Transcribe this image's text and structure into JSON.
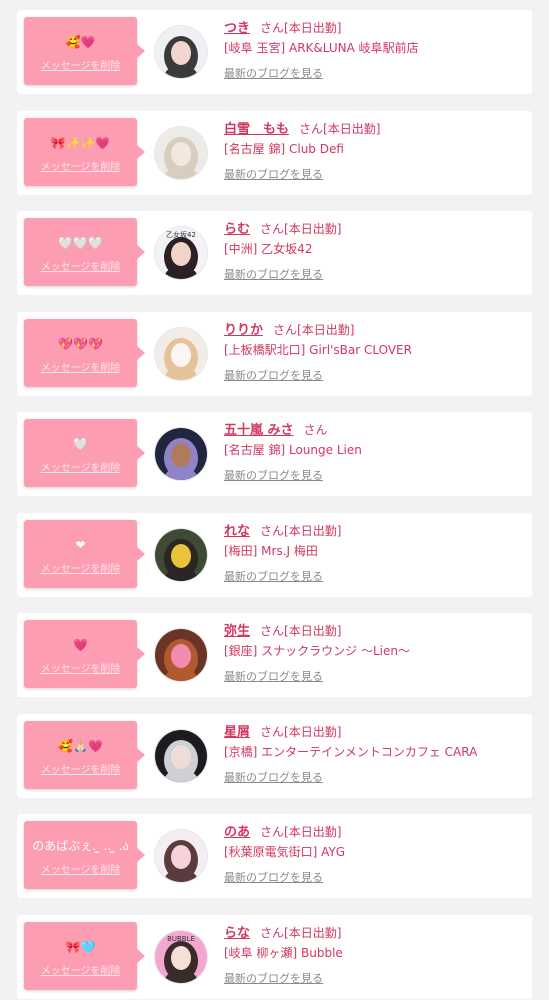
{
  "colors": {
    "page_background": "#f2f2f4",
    "card_background": "#ffffff",
    "bubble_pink": "#fd9db1",
    "name_pink": "#d3375f",
    "link_gray": "#8a8a8a"
  },
  "cards": [
    {
      "message": "🥰💗",
      "delete_label": "メッセージを削除",
      "name": "つき",
      "honorific": "さん",
      "status": "[本日出勤]",
      "shop": "[岐阜 玉宮] ARK&LUNA 岐阜駅前店",
      "blog_link": "最新のブログを見る",
      "avatar_colors": [
        "#eef0f4",
        "#3a3a3a",
        "#f0d6cf"
      ]
    },
    {
      "message": "🎀✨✨💗",
      "delete_label": "メッセージを削除",
      "name": "白雪　もも",
      "honorific": "さん",
      "status": "[本日出勤]",
      "shop": "[名古屋 錦] Club Defi",
      "blog_link": "最新のブログを見る",
      "avatar_colors": [
        "#ecebea",
        "#d8cdbf",
        "#f3e8df"
      ]
    },
    {
      "message": "🤍🤍🤍",
      "delete_label": "メッセージを削除",
      "name": "らむ",
      "honorific": "さん",
      "status": "[本日出勤]",
      "shop": "[中洲] 乙女坂42",
      "blog_link": "最新のブログを見る",
      "avatar_colors": [
        "#f4f2f6",
        "#2b2124",
        "#f1d4c8"
      ],
      "avatar_caption": "乙女坂42"
    },
    {
      "message": "💖💖💖",
      "delete_label": "メッセージを削除",
      "name": "りりか",
      "honorific": "さん",
      "status": "[本日出勤]",
      "shop": "[上板橋駅北口] Girl'sBar CLOVER",
      "blog_link": "最新のブログを見る",
      "avatar_colors": [
        "#f3ece6",
        "#e6c29b",
        "#fbf6f3"
      ]
    },
    {
      "message": "🤍",
      "delete_label": "メッセージを削除",
      "name": "五十嵐 みさ",
      "honorific": "さん",
      "status": "",
      "shop": "[名古屋 錦] Lounge Lien",
      "blog_link": "最新のブログを見る",
      "avatar_colors": [
        "#202540",
        "#8f84c9",
        "#b07a5e"
      ]
    },
    {
      "message": "❤",
      "delete_label": "メッセージを削除",
      "name": "れな",
      "honorific": "さん",
      "status": "[本日出勤]",
      "shop": "[梅田] Mrs.J 梅田",
      "blog_link": "最新のブログを見る",
      "avatar_colors": [
        "#3f4a35",
        "#2a2623",
        "#e9c33a"
      ]
    },
    {
      "message": "💗",
      "delete_label": "メッセージを削除",
      "name": "弥生",
      "honorific": "さん",
      "status": "[本日出勤]",
      "shop": "[銀座] スナックラウンジ 〜Lien〜",
      "blog_link": "最新のブログを見る",
      "avatar_colors": [
        "#6b3526",
        "#b3592f",
        "#f28bb0"
      ]
    },
    {
      "message": "🥰🙏🏻💗",
      "delete_label": "メッセージを削除",
      "name": "星屑",
      "honorific": "さん",
      "status": "[本日出勤]",
      "shop": "[京橋] エンターテインメントコンカフェ CARA",
      "blog_link": "最新のブログを見る",
      "avatar_colors": [
        "#1b1b20",
        "#cfcfd6",
        "#f0dcd6"
      ]
    },
    {
      "message": "のあばぶぇ. ̫ .. ̫ .ა",
      "delete_label": "メッセージを削除",
      "name": "のあ",
      "honorific": "さん",
      "status": "[本日出勤]",
      "shop": "[秋葉原電気街口] AYG",
      "blog_link": "最新のブログを見る",
      "avatar_colors": [
        "#f4eef3",
        "#5b3c3c",
        "#f7d0dc"
      ]
    },
    {
      "message": "🎀🩵",
      "delete_label": "メッセージを削除",
      "name": "らな",
      "honorific": "さん",
      "status": "[本日出勤]",
      "shop": "[岐阜 柳ヶ瀬] Bubble",
      "blog_link": "最新のブログを見る",
      "avatar_colors": [
        "#f3a6cf",
        "#3a2b2b",
        "#f6dfd6"
      ],
      "avatar_caption": "BUBBLE"
    }
  ]
}
